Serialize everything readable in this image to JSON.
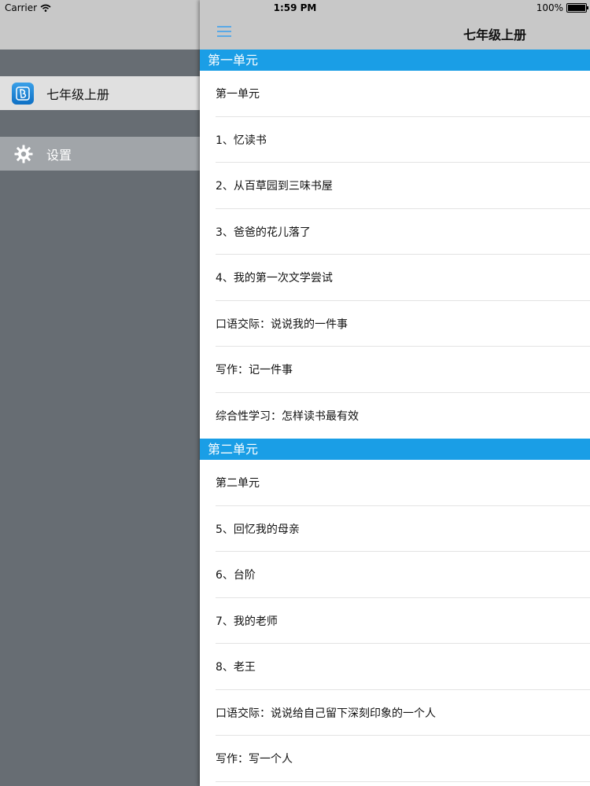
{
  "status": {
    "carrier": "Carrier",
    "time": "1:59 PM",
    "battery": "100%"
  },
  "sidebar": {
    "items": [
      {
        "label": "七年级上册",
        "icon": "book-app-icon"
      },
      {
        "label": "设置",
        "icon": "gear-icon"
      }
    ]
  },
  "nav": {
    "title": "七年级上册"
  },
  "sections": [
    {
      "header": "第一单元",
      "rows": [
        "第一单元",
        "1、忆读书",
        "2、从百草园到三味书屋",
        "3、爸爸的花儿落了",
        "4、我的第一次文学尝试",
        "口语交际：说说我的一件事",
        "写作：记一件事",
        "综合性学习：怎样读书最有效"
      ]
    },
    {
      "header": "第二单元",
      "rows": [
        "第二单元",
        "5、回忆我的母亲",
        "6、台阶",
        "7、我的老师",
        "8、老王",
        "口语交际：说说给自己留下深刻印象的一个人",
        "写作：写一个人"
      ]
    }
  ],
  "colors": {
    "accent": "#1a9ee6",
    "sidebar_bg": "#676d73",
    "bar_bg": "#c8c8c8"
  }
}
